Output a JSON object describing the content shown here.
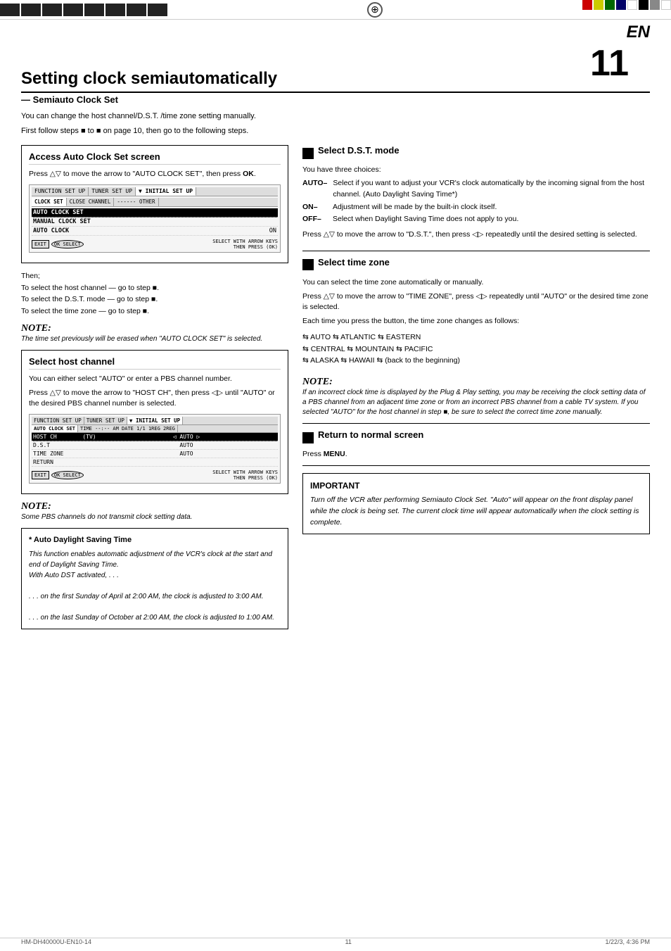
{
  "page": {
    "en_label": "EN",
    "page_number": "11",
    "footer_left": "HM-DH40000U-EN10-14",
    "footer_center": "11",
    "footer_right": "1/22/3, 4:36 PM"
  },
  "top_bar": {
    "left_blocks": [
      "■",
      "■",
      "■",
      "■",
      "■",
      "■",
      "■",
      "■"
    ],
    "right_squares": [
      "red",
      "yellow",
      "green",
      "blue",
      "white",
      "black",
      "gray",
      "white",
      "black"
    ]
  },
  "title": {
    "main": "Setting clock semiautomatically",
    "subtitle": "— Semiauto Clock Set",
    "intro_line1": "You can change the host channel/D.S.T. /time zone setting manually.",
    "intro_line2": "First follow steps ■ to ■ on page 10, then go to the following steps."
  },
  "access_section": {
    "title": "Access Auto Clock Set screen",
    "instruction": "Press △▽ to move the arrow to \"AUTO CLOCK SET\", then press OK.",
    "screen1": {
      "tabs": [
        "FUNCTION SET UP",
        "TUNER SET UP",
        "INITIAL SET UP"
      ],
      "active_tab": "INITIAL SET UP",
      "sub_tabs": [
        "CLOCK SET",
        "CLOSE CHANNEL",
        "OTHER"
      ],
      "active_sub": "CLOCK SET",
      "rows": [
        {
          "label": "AUTO CLOCK SET",
          "value": "",
          "selected": true,
          "arrow": "►"
        },
        {
          "label": "MANUAL CLOCK SET",
          "value": "",
          "selected": false
        },
        {
          "label": "AUTO CLOCK",
          "value": "ON",
          "selected": false
        }
      ]
    },
    "screen1_bottom": "SELECT WITH ARROW KEYS THEN PRESS (OK)"
  },
  "then_steps": {
    "intro": "Then;",
    "step1": "To select the host channel — go to step ■.",
    "step2": "To select the D.S.T. mode — go to step ■.",
    "step3": "To select the time zone — go to step ■."
  },
  "note1": {
    "title": "NOTE:",
    "text": "The time set previously will be erased when \"AUTO CLOCK SET\" is selected."
  },
  "host_channel_section": {
    "title": "Select host channel",
    "text1": "You can either select \"AUTO\" or enter a PBS channel number.",
    "text2": "Press △▽ to move the arrow to \"HOST CH\", then press ◁▷ until \"AUTO\" or the desired PBS channel number is selected.",
    "screen2": {
      "tabs": [
        "FUNCTION SET UP",
        "TUNER SET UP",
        "INITIAL SET UP"
      ],
      "active_tab": "INITIAL SET UP",
      "sub_tabs": [
        "AUTO CLOCK SET",
        "TIME --- AM DATE 1/1 1REG 2REG"
      ],
      "rows": [
        {
          "label": "HOST CH",
          "col2": "(TV)",
          "col3": "◁ AUTO ▷",
          "selected": true
        },
        {
          "label": "D.S.T",
          "col2": "",
          "col3": "AUTO",
          "selected": false
        },
        {
          "label": "TIME ZONE",
          "col2": "",
          "col3": "AUTO",
          "selected": false
        },
        {
          "label": "RETURN",
          "col2": "",
          "col3": "",
          "selected": false
        }
      ]
    },
    "screen2_bottom": "SELECT WITH ARROW KEYS THEN PRESS (OK)"
  },
  "note2": {
    "title": "NOTE:",
    "text": "Some PBS channels do not transmit clock setting data."
  },
  "auto_dst": {
    "title": "* Auto Daylight Saving Time",
    "line1": "This function enables automatic adjustment of the VCR's clock at the start and end of Daylight Saving Time.",
    "line2": "With Auto DST activated, . . .",
    "line3": ". . . on the first Sunday of April at 2:00 AM, the clock is adjusted to 3:00 AM.",
    "line4": ". . . on the last Sunday of October at 2:00 AM, the clock is adjusted to 1:00 AM."
  },
  "select_dst": {
    "title": "Select D.S.T. mode",
    "intro": "You have three choices:",
    "choices": [
      {
        "mode": "AUTO–",
        "desc": "Select if you want to adjust your VCR's clock automatically by the incoming signal from the host channel. (Auto Daylight Saving Time*)"
      },
      {
        "mode": "ON–",
        "desc": "Adjustment will be made by the built-in clock itself."
      },
      {
        "mode": "OFF–",
        "desc": "Select when Daylight Saving Time does not apply to you."
      }
    ],
    "instruction": "Press △▽ to move the arrow to \"D.S.T.\", then press ◁▷ repeatedly until the desired setting is selected."
  },
  "select_tz": {
    "title": "Select time zone",
    "text1": "You can select the time zone automatically or manually.",
    "text2": "Press △▽ to move the arrow to \"TIME ZONE\", press ◁▷ repeatedly until \"AUTO\" or the desired time zone is selected.",
    "text3": "Each time you press the button, the time zone changes as follows:",
    "zones": [
      "⇆ AUTO ⇆ ATLANTIC ⇆ EASTERN",
      "⇆ CENTRAL ⇆ MOUNTAIN ⇆ PACIFIC",
      "⇆ ALASKA ⇆ HAWAII ⇆ (back to the beginning)"
    ]
  },
  "note3": {
    "title": "NOTE:",
    "text": "If an incorrect clock time is displayed by the Plug & Play setting, you may be receiving the clock setting data of a PBS channel from an adjacent time zone or from an incorrect PBS channel from a cable TV system. If you selected \"AUTO\" for the host channel in step ■, be sure to select the correct time zone manually."
  },
  "return_section": {
    "title": "Return to normal screen",
    "text": "Press MENU."
  },
  "important": {
    "title": "IMPORTANT",
    "text": "Turn off the VCR after performing Semiauto Clock Set. \"Auto\" will appear on the front display panel while the clock is being set. The current clock time will appear automatically when the clock setting is complete."
  }
}
